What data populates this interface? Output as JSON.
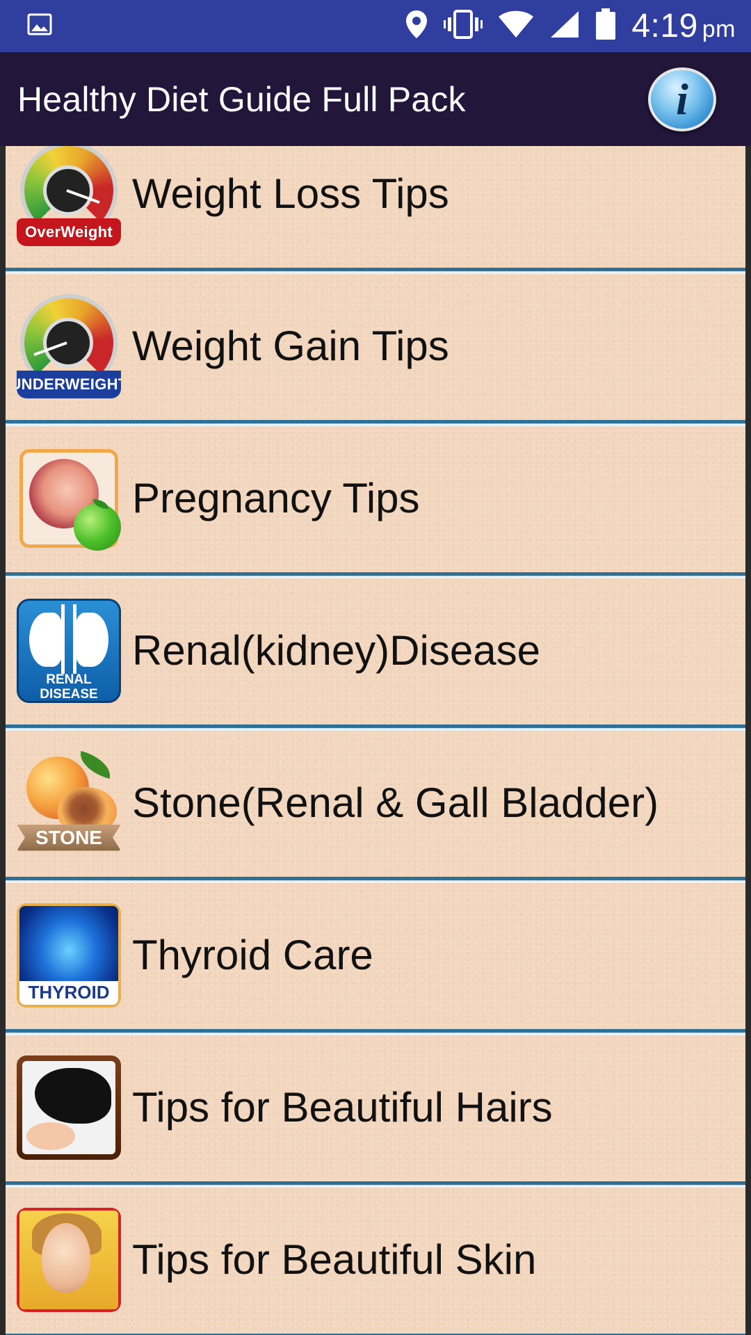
{
  "status_bar": {
    "time": "4:19",
    "ampm": "pm",
    "icons": [
      "image-icon",
      "location-icon",
      "vibrate-icon",
      "wifi-icon",
      "signal-icon",
      "battery-icon"
    ]
  },
  "app_bar": {
    "title": "Healthy Diet Guide Full Pack",
    "info_button_glyph": "i"
  },
  "list": {
    "items": [
      {
        "label": "Weight Loss Tips",
        "icon": "overweight-gauge-icon",
        "badge": "OverWeight"
      },
      {
        "label": "Weight Gain Tips",
        "icon": "underweight-gauge-icon",
        "badge": "UNDERWEIGHT"
      },
      {
        "label": "Pregnancy Tips",
        "icon": "pregnancy-icon"
      },
      {
        "label": "Renal(kidney)Disease",
        "icon": "renal-disease-icon",
        "badge_line1": "RENAL",
        "badge_line2": "DISEASE"
      },
      {
        "label": "Stone(Renal & Gall Bladder)",
        "icon": "stone-peach-icon",
        "badge": "STONE"
      },
      {
        "label": "Thyroid Care",
        "icon": "thyroid-icon",
        "badge": "THYROID"
      },
      {
        "label": "Tips for Beautiful Hairs",
        "icon": "hair-icon"
      },
      {
        "label": "Tips for Beautiful Skin",
        "icon": "skin-icon"
      }
    ]
  },
  "colors": {
    "status_bar": "#303f9f",
    "app_bar": "#22163b",
    "list_background": "#f2d6be",
    "divider": "#2f6f96"
  }
}
